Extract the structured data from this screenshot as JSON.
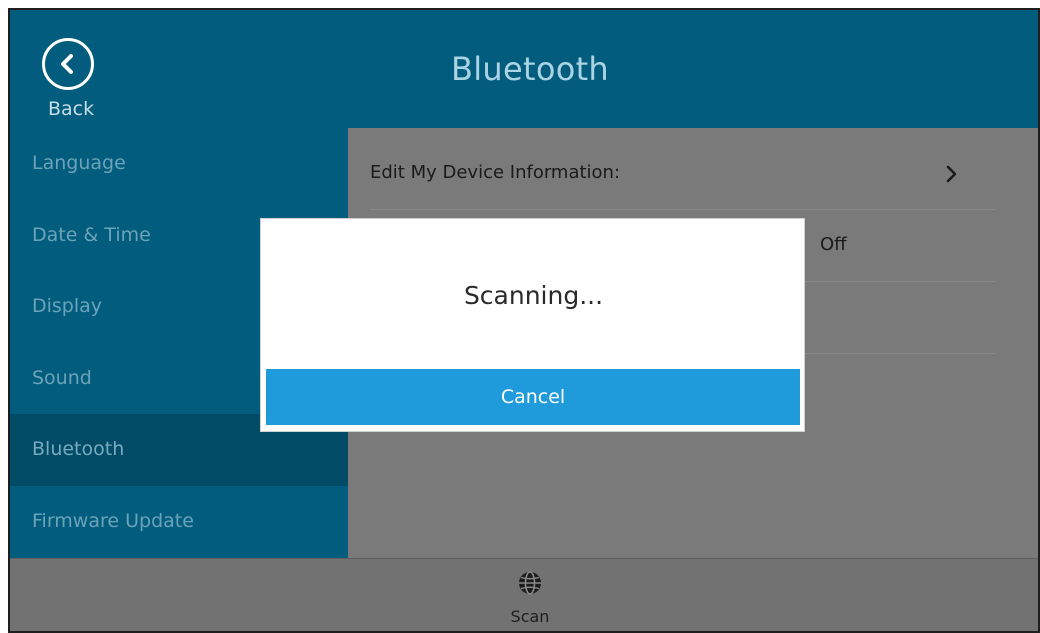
{
  "header": {
    "title": "Bluetooth",
    "back_label": "Back",
    "back_icon": "chevron-left-icon"
  },
  "sidebar": {
    "items": [
      {
        "label": "Language"
      },
      {
        "label": "Date & Time"
      },
      {
        "label": "Display"
      },
      {
        "label": "Sound"
      },
      {
        "label": "Bluetooth",
        "active": true
      },
      {
        "label": "Firmware Update"
      }
    ]
  },
  "content": {
    "rows": [
      {
        "label": "Edit My Device Information:",
        "icon": "chevron-right-icon"
      },
      {
        "value": "Off"
      }
    ]
  },
  "bottombar": {
    "scan_label": "Scan",
    "scan_icon": "globe-icon"
  },
  "dialog": {
    "message": "Scanning...",
    "cancel_label": "Cancel"
  },
  "colors": {
    "header_bg": "#025c7d",
    "sidebar_active_bg": "#014b66",
    "content_overlay": "#7a7a7a",
    "accent_button": "#1f9bdc"
  }
}
